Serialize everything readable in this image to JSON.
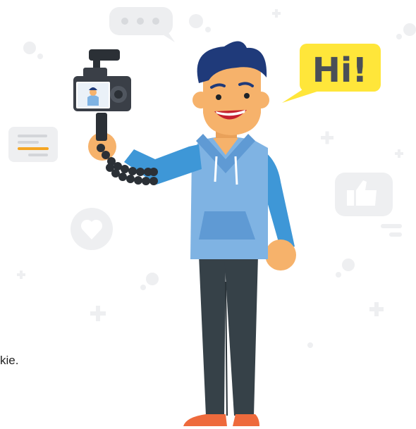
{
  "speech_bubble": {
    "text": "Hi!"
  },
  "cropped_text": {
    "text": "kie."
  },
  "colors": {
    "hair": "#1F3A7A",
    "skin": "#F6B26B",
    "hoodie": "#7FB3E3",
    "sleeve": "#3E97D7",
    "pants": "#364148",
    "shoes": "#EE6A3C",
    "camera": "#3A3F47",
    "bubble": "#FFE63A",
    "bubble_text": "#4A4F57",
    "decor": "#EDEEF0"
  },
  "icons": [
    "ellipsis-chat-icon",
    "text-lines-icon",
    "heart-icon",
    "thumbs-up-icon",
    "plus-icon"
  ]
}
